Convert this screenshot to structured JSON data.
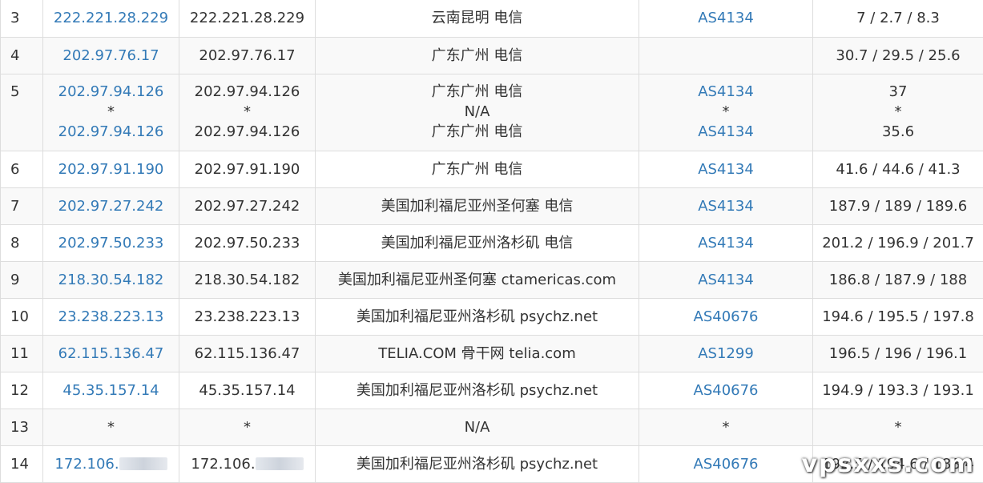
{
  "colors": {
    "link": "#337ab7",
    "text": "#333333",
    "border": "#dddddd",
    "stripe": "#f9f9f9"
  },
  "watermark": "vpsxxs.com",
  "hops": [
    {
      "hop": "3",
      "ip": "222.221.28.229",
      "host": "222.221.28.229",
      "location": "云南昆明 电信",
      "asn": "AS4134",
      "latency": "7 / 2.7 / 8.3"
    },
    {
      "hop": "4",
      "ip": "202.97.76.17",
      "host": "202.97.76.17",
      "location": "广东广州 电信",
      "asn": "",
      "latency": "30.7 / 29.5 / 25.6"
    },
    {
      "hop": "5",
      "ip": [
        "202.97.94.126",
        "*",
        "202.97.94.126"
      ],
      "host": [
        "202.97.94.126",
        "*",
        "202.97.94.126"
      ],
      "location": [
        "广东广州 电信",
        "N/A",
        "广东广州 电信"
      ],
      "asn": [
        "AS4134",
        "*",
        "AS4134"
      ],
      "latency": [
        "37",
        "*",
        "35.6"
      ]
    },
    {
      "hop": "6",
      "ip": "202.97.91.190",
      "host": "202.97.91.190",
      "location": "广东广州 电信",
      "asn": "AS4134",
      "latency": "41.6 / 44.6 / 41.3"
    },
    {
      "hop": "7",
      "ip": "202.97.27.242",
      "host": "202.97.27.242",
      "location": "美国加利福尼亚州圣何塞 电信",
      "asn": "AS4134",
      "latency": "187.9 / 189 / 189.6"
    },
    {
      "hop": "8",
      "ip": "202.97.50.233",
      "host": "202.97.50.233",
      "location": "美国加利福尼亚州洛杉矶 电信",
      "asn": "AS4134",
      "latency": "201.2 / 196.9 / 201.7"
    },
    {
      "hop": "9",
      "ip": "218.30.54.182",
      "host": "218.30.54.182",
      "location": "美国加利福尼亚州圣何塞 ctamericas.com",
      "asn": "AS4134",
      "latency": "186.8 / 187.9 / 188"
    },
    {
      "hop": "10",
      "ip": "23.238.223.13",
      "host": "23.238.223.13",
      "location": "美国加利福尼亚州洛杉矶 psychz.net",
      "asn": "AS40676",
      "latency": "194.6 / 195.5 / 197.8"
    },
    {
      "hop": "11",
      "ip": "62.115.136.47",
      "host": "62.115.136.47",
      "location": "TELIA.COM 骨干网 telia.com",
      "asn": "AS1299",
      "latency": "196.5 / 196 / 196.1"
    },
    {
      "hop": "12",
      "ip": "45.35.157.14",
      "host": "45.35.157.14",
      "location": "美国加利福尼亚州洛杉矶 psychz.net",
      "asn": "AS40676",
      "latency": "194.9 / 193.3 / 193.1"
    },
    {
      "hop": "13",
      "ip": "*",
      "host": "*",
      "location": "N/A",
      "asn": "*",
      "latency": "*"
    },
    {
      "hop": "14",
      "ip": "172.106.",
      "host": "172.106.",
      "location": "美国加利福尼亚州洛杉矶 psychz.net",
      "asn": "AS40676",
      "latency": "192.5 / 194.6 / 188.4"
    }
  ]
}
